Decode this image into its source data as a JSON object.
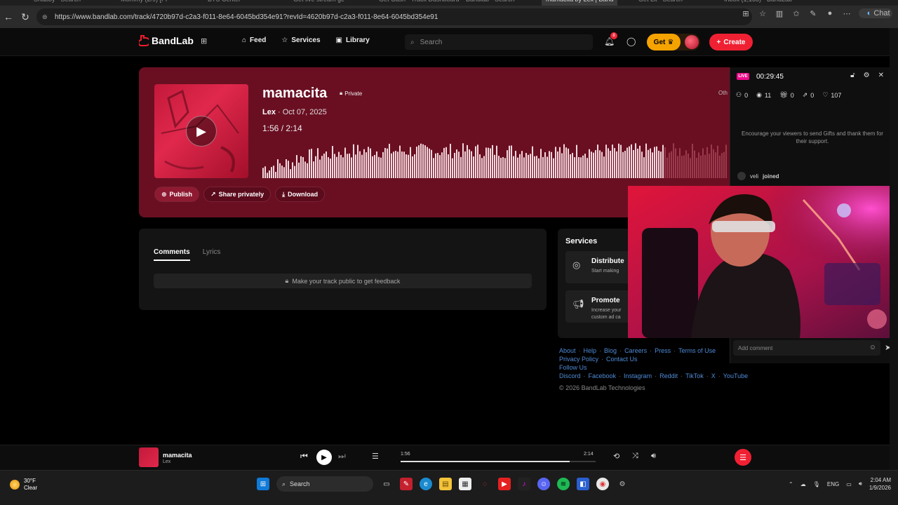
{
  "browser": {
    "tabs": [
      "Shabby - Search",
      "Mommy (2/9) [Pr",
      "BTS Center",
      "Get live stream ge",
      "Get Cash - Track Dashboard",
      "Bandlab - Search",
      "mamacita by Lex | Band",
      "Get Lit - Search",
      "Inbox (1,133) - BandLab"
    ],
    "url": "https://www.bandlab.com/track/4720b97d-c2a3-f011-8e64-6045bd354e91?revId=4620b97d-c2a3-f011-8e64-6045bd354e91",
    "chat_label": "Chat"
  },
  "header": {
    "logo": "BandLab",
    "nav": [
      "Feed",
      "Services",
      "Library"
    ],
    "search_placeholder": "Search",
    "notification_count": "8",
    "get_label": "Get",
    "create_label": "Create"
  },
  "track": {
    "title": "mamacita",
    "privacy": "Private",
    "artist": "Lex",
    "date": " · Oct 07, 2025",
    "current_time": "1:56",
    "separator": " / ",
    "duration": "2:14",
    "progress": 0.866,
    "other_label": "Oth",
    "actions": [
      "Publish",
      "Share privately",
      "Download"
    ]
  },
  "comments": {
    "tabs": [
      "Comments",
      "Lyrics"
    ],
    "notice": "Make your track public to get feedback"
  },
  "services": {
    "title": "Services",
    "items": [
      {
        "name": "Distribute",
        "desc": "Start making"
      },
      {
        "name": "Promote",
        "desc": "Increase your custom ad ca"
      }
    ]
  },
  "footer": {
    "links1": [
      "About",
      "Help",
      "Blog",
      "Careers",
      "Press",
      "Terms of Use"
    ],
    "links2": [
      "Privacy Policy",
      "Contact Us"
    ],
    "follow_label": "Follow Us",
    "social": [
      "Discord",
      "Facebook",
      "Instagram",
      "Reddit",
      "TikTok",
      "X",
      "YouTube"
    ],
    "copyright": "© 2026 BandLab Technologies"
  },
  "live": {
    "badge": "LIVE",
    "time": "00:29:45",
    "stats": [
      "0",
      "11",
      "0",
      "0",
      "107"
    ],
    "encourage": "Encourage your viewers to send Gifts and thank them for their support.",
    "joined_user": "veli",
    "joined_text": "joined",
    "comment_placeholder": "Add comment"
  },
  "player": {
    "title": "mamacita",
    "artist": "Lex",
    "current": "1:56",
    "duration": "2:14",
    "progress": 0.866
  },
  "taskbar": {
    "temp": "30°F",
    "condition": "Clear",
    "search_label": "Search",
    "lang": "ENG",
    "time": "2:04 AM",
    "date": "1/9/2026"
  }
}
